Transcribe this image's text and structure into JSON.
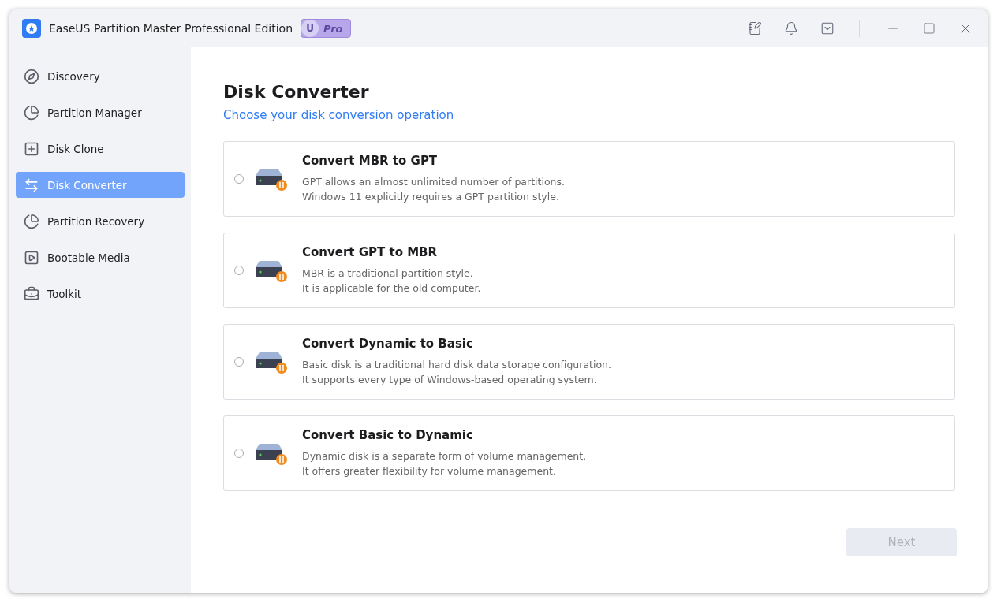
{
  "window": {
    "title": "EaseUS Partition Master Professional Edition",
    "badge": "Pro",
    "badge_letter": "U"
  },
  "sidebar": {
    "items": [
      {
        "label": "Discovery",
        "selected": false
      },
      {
        "label": "Partition Manager",
        "selected": false
      },
      {
        "label": "Disk Clone",
        "selected": false
      },
      {
        "label": "Disk Converter",
        "selected": true
      },
      {
        "label": "Partition Recovery",
        "selected": false
      },
      {
        "label": "Bootable Media",
        "selected": false
      },
      {
        "label": "Toolkit",
        "selected": false
      }
    ]
  },
  "main": {
    "title": "Disk Converter",
    "subtitle": "Choose your disk conversion operation",
    "options": [
      {
        "title": "Convert MBR to GPT",
        "lines": [
          "GPT allows an almost unlimited number of partitions.",
          "Windows 11 explicitly requires a GPT partition style."
        ],
        "selected": false
      },
      {
        "title": "Convert GPT to MBR",
        "lines": [
          "MBR is a traditional partition style.",
          "It is applicable for the old computer."
        ],
        "selected": false
      },
      {
        "title": "Convert Dynamic to Basic",
        "lines": [
          "Basic disk is a traditional hard disk data storage configuration.",
          "It supports every type of Windows-based operating system."
        ],
        "selected": false
      },
      {
        "title": "Convert Basic to Dynamic",
        "lines": [
          "Dynamic disk is a separate form of volume management.",
          "It offers greater flexibility for volume management."
        ],
        "selected": false
      }
    ],
    "next_button": {
      "label": "Next",
      "disabled": true
    }
  }
}
